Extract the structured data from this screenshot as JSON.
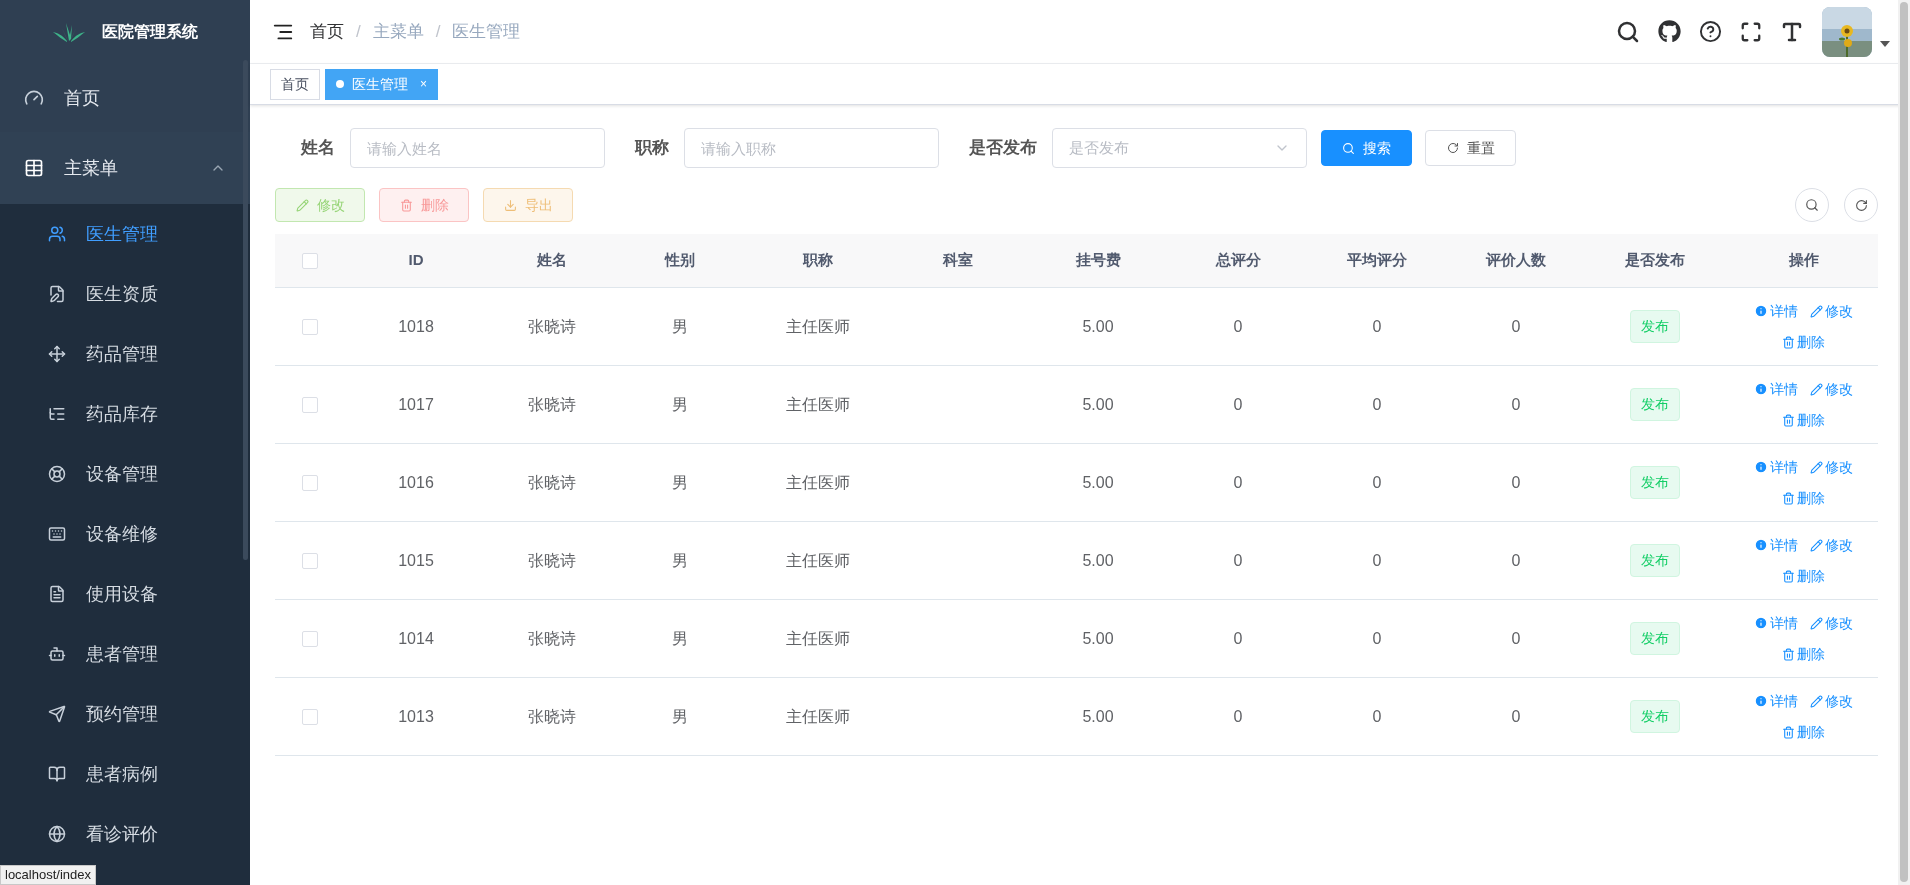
{
  "sidebar": {
    "title": "医院管理系统",
    "items": [
      {
        "label": "首页",
        "kind": "link",
        "selected": false
      },
      {
        "label": "主菜单",
        "kind": "group",
        "expanded": true,
        "children": [
          {
            "label": "医生管理",
            "selected": true
          },
          {
            "label": "医生资质",
            "selected": false
          },
          {
            "label": "药品管理",
            "selected": false
          },
          {
            "label": "药品库存",
            "selected": false
          },
          {
            "label": "设备管理",
            "selected": false
          },
          {
            "label": "设备维修",
            "selected": false
          },
          {
            "label": "使用设备",
            "selected": false
          },
          {
            "label": "患者管理",
            "selected": false
          },
          {
            "label": "预约管理",
            "selected": false
          },
          {
            "label": "患者病例",
            "selected": false
          },
          {
            "label": "看诊评价",
            "selected": false
          }
        ]
      }
    ]
  },
  "status_tooltip": "localhost/index",
  "breadcrumb": [
    "首页",
    "主菜单",
    "医生管理"
  ],
  "breadcrumb_separator": "/",
  "tags": [
    {
      "label": "首页",
      "selected": false
    },
    {
      "label": "医生管理",
      "selected": true,
      "close": "×"
    }
  ],
  "search": {
    "fields": [
      {
        "label": "姓名",
        "placeholder": "请输入姓名",
        "kind": "input"
      },
      {
        "label": "职称",
        "placeholder": "请输入职称",
        "kind": "input"
      },
      {
        "label": "是否发布",
        "placeholder": "是否发布",
        "kind": "select"
      }
    ],
    "buttons": [
      {
        "label": "搜索",
        "kind": "primary"
      },
      {
        "label": "重置",
        "kind": "default"
      }
    ]
  },
  "actions": [
    {
      "label": "修改",
      "kind": "edit",
      "disabled": true
    },
    {
      "label": "删除",
      "kind": "delete",
      "disabled": true
    },
    {
      "label": "导出",
      "kind": "export",
      "disabled": true
    }
  ],
  "table": {
    "all_checked": false,
    "columns": [
      "ID",
      "姓名",
      "性别",
      "职称",
      "科室",
      "挂号费",
      "总评分",
      "平均评分",
      "评价人数",
      "是否发布",
      "操作"
    ],
    "rows": [
      {
        "checked": false,
        "id": "1018",
        "name": "张晓诗",
        "gender": "男",
        "title": "主任医师",
        "fee": "5.00",
        "total": "0",
        "avg": "0",
        "count": "0",
        "status": "发布",
        "ops": [
          "详情",
          "修改",
          "删除"
        ]
      },
      {
        "checked": false,
        "id": "1017",
        "name": "张晓诗",
        "gender": "男",
        "title": "主任医师",
        "fee": "5.00",
        "total": "0",
        "avg": "0",
        "count": "0",
        "status": "发布",
        "ops": [
          "详情",
          "修改",
          "删除"
        ]
      },
      {
        "checked": false,
        "id": "1016",
        "name": "张晓诗",
        "gender": "男",
        "title": "主任医师",
        "fee": "5.00",
        "total": "0",
        "avg": "0",
        "count": "0",
        "status": "发布",
        "ops": [
          "详情",
          "修改",
          "删除"
        ]
      },
      {
        "checked": false,
        "id": "1015",
        "name": "张晓诗",
        "gender": "男",
        "title": "主任医师",
        "fee": "5.00",
        "total": "0",
        "avg": "0",
        "count": "0",
        "status": "发布",
        "ops": [
          "详情",
          "修改",
          "删除"
        ]
      },
      {
        "checked": false,
        "id": "1014",
        "name": "张晓诗",
        "gender": "男",
        "title": "主任医师",
        "fee": "5.00",
        "total": "0",
        "avg": "0",
        "count": "0",
        "status": "发布",
        "ops": [
          "详情",
          "修改",
          "删除"
        ]
      },
      {
        "checked": false,
        "id": "1013",
        "name": "张晓诗",
        "gender": "男",
        "title": "主任医师",
        "fee": "5.00",
        "total": "0",
        "avg": "0",
        "count": "0",
        "status": "发布",
        "ops": [
          "详情",
          "修改",
          "删除"
        ]
      }
    ]
  }
}
